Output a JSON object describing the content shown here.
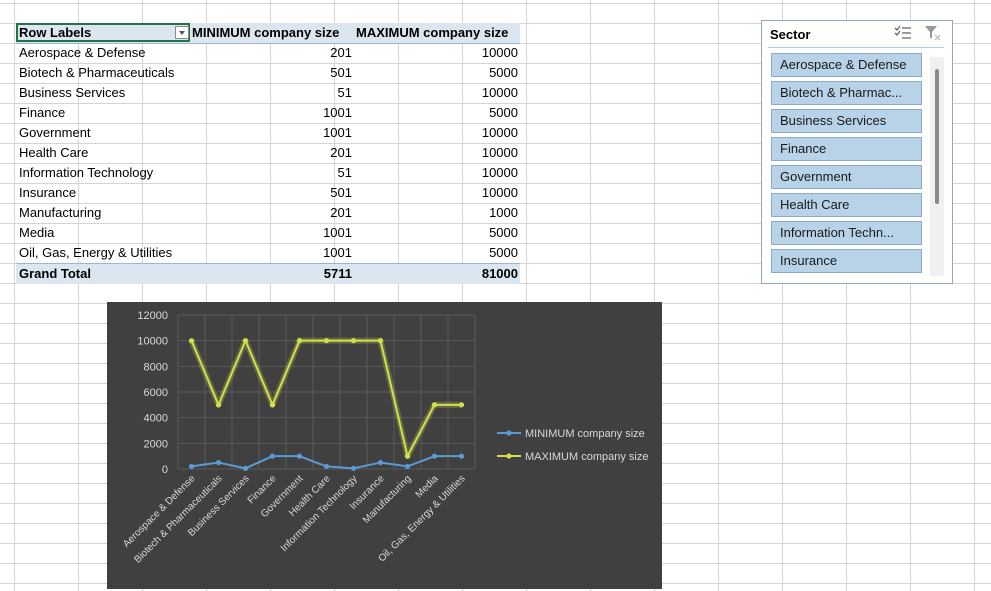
{
  "pivot": {
    "headers": [
      "Row Labels",
      "MINIMUM company size",
      "MAXIMUM company size"
    ],
    "rows": [
      {
        "label": "Aerospace & Defense",
        "min": "201",
        "max": "10000"
      },
      {
        "label": "Biotech & Pharmaceuticals",
        "min": "501",
        "max": "5000"
      },
      {
        "label": "Business Services",
        "min": "51",
        "max": "10000"
      },
      {
        "label": "Finance",
        "min": "1001",
        "max": "5000"
      },
      {
        "label": "Government",
        "min": "1001",
        "max": "10000"
      },
      {
        "label": "Health Care",
        "min": "201",
        "max": "10000"
      },
      {
        "label": "Information Technology",
        "min": "51",
        "max": "10000"
      },
      {
        "label": "Insurance",
        "min": "501",
        "max": "10000"
      },
      {
        "label": "Manufacturing",
        "min": "201",
        "max": "1000"
      },
      {
        "label": "Media",
        "min": "1001",
        "max": "5000"
      },
      {
        "label": "Oil, Gas, Energy & Utilities",
        "min": "1001",
        "max": "5000"
      }
    ],
    "total": {
      "label": "Grand Total",
      "min": "5711",
      "max": "81000"
    }
  },
  "slicer": {
    "title": "Sector",
    "items": [
      "Aerospace & Defense",
      "Biotech & Pharmac...",
      "Business Services",
      "Finance",
      "Government",
      "Health Care",
      "Information Techn...",
      "Insurance"
    ],
    "icons": [
      "multi-select-icon",
      "clear-filter-icon"
    ]
  },
  "chart_data": {
    "type": "line",
    "categories": [
      "Aerospace & Defense",
      "Biotech & Pharmaceuticals",
      "Business Services",
      "Finance",
      "Government",
      "Health Care",
      "Information Technology",
      "Insurance",
      "Manufacturing",
      "Media",
      "Oil, Gas, Energy & Utilities"
    ],
    "series": [
      {
        "name": "MINIMUM company size",
        "values": [
          201,
          501,
          51,
          1001,
          1001,
          201,
          51,
          501,
          201,
          1001,
          1001
        ],
        "color": "#5b9bd5"
      },
      {
        "name": "MAXIMUM company size",
        "values": [
          10000,
          5000,
          10000,
          5000,
          10000,
          10000,
          10000,
          10000,
          1000,
          5000,
          5000
        ],
        "color": "#d4e04a"
      }
    ],
    "yticks": [
      "0",
      "2000",
      "4000",
      "6000",
      "8000",
      "10000",
      "12000"
    ],
    "ylim": [
      0,
      12000
    ],
    "grid": true,
    "legend": "right",
    "background": "#404040"
  }
}
